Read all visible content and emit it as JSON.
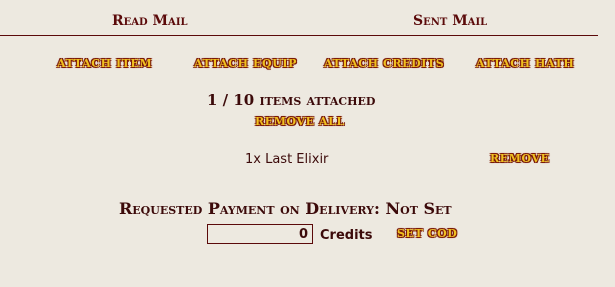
{
  "tabs": {
    "read_mail": "Read Mail",
    "sent_mail": "Sent Mail"
  },
  "attach_buttons": {
    "item": "ATTACH ITEM",
    "equip": "ATTACH EQUIP",
    "credits": "ATTACH CREDITS",
    "hath": "ATTACH HATH"
  },
  "attachment_status": "1 / 10 items attached",
  "remove_all_label": "REMOVE ALL",
  "attachments": [
    {
      "label": "1x Last Elixir",
      "remove_label": "REMOVE"
    }
  ],
  "cod": {
    "label": "Requested Payment on Delivery: Not Set",
    "value": "0",
    "unit": "Credits",
    "set_label": "SET COD"
  },
  "colors": {
    "text": "#5b0a0a",
    "background": "#ede9e0",
    "button_fill": "#f0c020",
    "button_outline": "#7a1a08"
  }
}
